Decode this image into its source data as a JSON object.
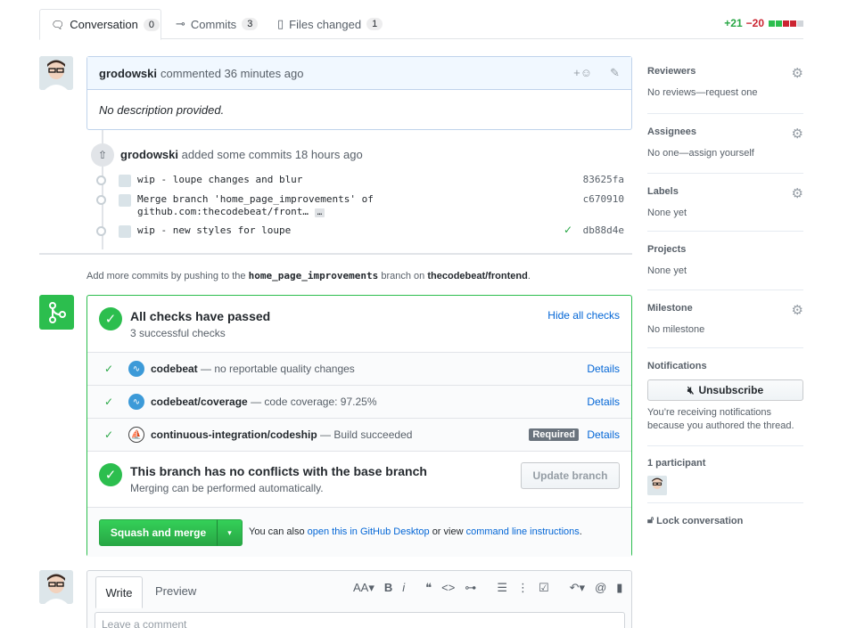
{
  "tabs": [
    {
      "label": "Conversation",
      "count": "0"
    },
    {
      "label": "Commits",
      "count": "3"
    },
    {
      "label": "Files changed",
      "count": "1"
    }
  ],
  "diffstat": {
    "additions": "+21",
    "deletions": "−20"
  },
  "comment": {
    "author": "grodowski",
    "action": "commented 36 minutes ago",
    "body": "No description provided."
  },
  "commits_event": {
    "author": "grodowski",
    "action": "added some commits 18 hours ago"
  },
  "commits": [
    {
      "message": "wip - loupe changes and blur",
      "sha": "83625fa"
    },
    {
      "message": "Merge branch 'home_page_improvements' of",
      "message2": "github.com:thecodebeat/front…",
      "ellipsis": "…",
      "sha": "c670910"
    },
    {
      "message": "wip - new styles for loupe",
      "sha": "db88d4e"
    }
  ],
  "push_hint": {
    "prefix": "Add more commits by pushing to the",
    "branch": "home_page_improvements",
    "middle": "branch on",
    "repo": "thecodebeat/frontend",
    "suffix": "."
  },
  "checks": {
    "title": "All checks have passed",
    "subtitle": "3 successful checks",
    "toggle": "Hide all checks",
    "items": [
      {
        "name": "codebeat",
        "desc": "— no reportable quality changes",
        "details": "Details",
        "required": ""
      },
      {
        "name": "codebeat/coverage",
        "desc": "— code coverage: 97.25%",
        "details": "Details",
        "required": ""
      },
      {
        "name": "continuous-integration/codeship",
        "desc": "— Build succeeded",
        "details": "Details",
        "required": "Required"
      }
    ]
  },
  "conflicts": {
    "title": "This branch has no conflicts with the base branch",
    "subtitle": "Merging can be performed automatically.",
    "update_button": "Update branch"
  },
  "merge": {
    "button": "Squash and merge",
    "prefix": "You can also",
    "desktop_link": "open this in GitHub Desktop",
    "middle": "or view",
    "cli_link": "command line instructions",
    "suffix": "."
  },
  "editor": {
    "tab_write": "Write",
    "tab_preview": "Preview",
    "placeholder": "Leave a comment"
  },
  "sidebar": {
    "reviewers": {
      "title": "Reviewers",
      "value": "No reviews—request one"
    },
    "assignees": {
      "title": "Assignees",
      "value": "No one—assign yourself"
    },
    "labels": {
      "title": "Labels",
      "value": "None yet"
    },
    "projects": {
      "title": "Projects",
      "value": "None yet"
    },
    "milestone": {
      "title": "Milestone",
      "value": "No milestone"
    },
    "notifications": {
      "title": "Notifications",
      "button": "Unsubscribe",
      "reason": "You’re receiving notifications because you authored the thread."
    },
    "participants": {
      "title": "1 participant"
    },
    "lock": "Lock conversation"
  },
  "colors": {
    "success": "#2cbe4e",
    "link": "#0366d6",
    "header_bg": "#f1f8ff"
  }
}
